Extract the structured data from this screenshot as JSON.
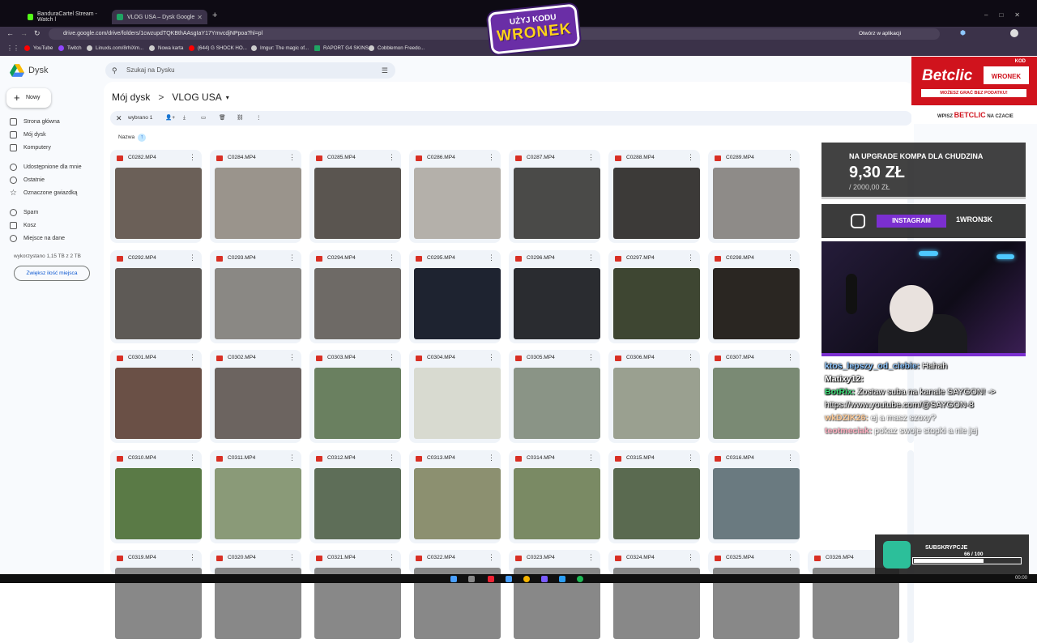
{
  "browser": {
    "tabs": [
      {
        "label": "BanduraCartel Stream - Watch l",
        "favicon_color": "#53fc18",
        "active": false
      },
      {
        "label": "VLOG USA – Dysk Google",
        "favicon_color": "#1fa463",
        "active": true
      }
    ],
    "new_tab_label": "+",
    "url": "drive.google.com/drive/folders/1cwzupdTQKBthAAsgIaY17YmvcdjNPpoa?hl=pl",
    "open_in_app_label": "Otwórz w aplikacji",
    "bookmarks": [
      {
        "label": "YouTube",
        "color": "#ff0000"
      },
      {
        "label": "Twitch",
        "color": "#9146ff"
      },
      {
        "label": "Linuxls.com/8rhiXm...",
        "color": "#cccccc"
      },
      {
        "label": "Nowa karta",
        "color": "#cccccc"
      },
      {
        "label": "(644) G SHOCK HO...",
        "color": "#ff0000"
      },
      {
        "label": "Imgur: The magic of...",
        "color": "#cccccc"
      },
      {
        "label": "RAPORT G4 SKINS",
        "color": "#1fa463"
      },
      {
        "label": "Cobblemon Freedo...",
        "color": "#cccccc"
      }
    ]
  },
  "promo_badge": {
    "line1": "UŻYJ KODU",
    "line2": "WRONEK"
  },
  "drive": {
    "app_name": "Dysk",
    "search_placeholder": "Szukaj na Dysku",
    "new_button": "Nowy",
    "nav": [
      {
        "label": "Strona główna",
        "icon": "home-icon"
      },
      {
        "label": "Mój dysk",
        "icon": "drive-icon"
      },
      {
        "label": "Komputery",
        "icon": "computer-icon"
      },
      {
        "label": "Udostępnione dla mnie",
        "icon": "shared-icon"
      },
      {
        "label": "Ostatnie",
        "icon": "clock-icon"
      },
      {
        "label": "Oznaczone gwiazdką",
        "icon": "star-icon"
      },
      {
        "label": "Spam",
        "icon": "spam-icon"
      },
      {
        "label": "Kosz",
        "icon": "trash-icon"
      },
      {
        "label": "Miejsce na dane",
        "icon": "cloud-icon"
      }
    ],
    "storage_text": "wykorzystano 1,15 TB z 2 TB",
    "storage_fraction": 0.575,
    "more_storage_button": "Zwiększ ilość miejsca",
    "breadcrumb": {
      "root": "Mój dysk",
      "separator": ">",
      "current": "VLOG USA"
    },
    "selection": {
      "label": "wybrano 1"
    },
    "sort_label": "Nazwa",
    "files": [
      {
        "name": "C0282.MP4",
        "thumb": "#6b6058"
      },
      {
        "name": "C0284.MP4",
        "thumb": "#9a948c"
      },
      {
        "name": "C0285.MP4",
        "thumb": "#5a5550"
      },
      {
        "name": "C0286.MP4",
        "thumb": "#b4b0aa"
      },
      {
        "name": "C0287.MP4",
        "thumb": "#4a4a48"
      },
      {
        "name": "C0288.MP4",
        "thumb": "#3c3a38"
      },
      {
        "name": "C0289.MP4",
        "thumb": "#8e8b88"
      },
      {
        "name": "C0292.MP4",
        "thumb": "#5e5a56"
      },
      {
        "name": "C0293.MP4",
        "thumb": "#8a8884"
      },
      {
        "name": "C0294.MP4",
        "thumb": "#6e6a66"
      },
      {
        "name": "C0295.MP4",
        "thumb": "#1e2330"
      },
      {
        "name": "C0296.MP4",
        "thumb": "#2a2c30"
      },
      {
        "name": "C0297.MP4",
        "thumb": "#3e4632"
      },
      {
        "name": "C0298.MP4",
        "thumb": "#2a2622"
      },
      {
        "name": "C0301.MP4",
        "thumb": "#6a5046"
      },
      {
        "name": "C0302.MP4",
        "thumb": "#6c6460"
      },
      {
        "name": "C0303.MP4",
        "thumb": "#6a8060"
      },
      {
        "name": "C0304.MP4",
        "thumb": "#d8dad0"
      },
      {
        "name": "C0305.MP4",
        "thumb": "#8a9486"
      },
      {
        "name": "C0306.MP4",
        "thumb": "#9aa090"
      },
      {
        "name": "C0307.MP4",
        "thumb": "#7a8a74"
      },
      {
        "name": "C0310.MP4",
        "thumb": "#5a7a46"
      },
      {
        "name": "C0311.MP4",
        "thumb": "#8a9a78"
      },
      {
        "name": "C0312.MP4",
        "thumb": "#5e6e58"
      },
      {
        "name": "C0313.MP4",
        "thumb": "#8c9070"
      },
      {
        "name": "C0314.MP4",
        "thumb": "#7a8a64"
      },
      {
        "name": "C0315.MP4",
        "thumb": "#5a6a50"
      },
      {
        "name": "C0316.MP4",
        "thumb": "#6a7a80"
      },
      {
        "name": "C0319.MP4",
        "thumb": "#888888"
      },
      {
        "name": "C0320.MP4",
        "thumb": "#888888"
      },
      {
        "name": "C0321.MP4",
        "thumb": "#888888"
      },
      {
        "name": "C0322.MP4",
        "thumb": "#888888"
      },
      {
        "name": "C0323.MP4",
        "thumb": "#888888"
      },
      {
        "name": "C0324.MP4",
        "thumb": "#888888"
      },
      {
        "name": "C0325.MP4",
        "thumb": "#888888"
      },
      {
        "name": "C0326.MP4",
        "thumb": "#888888"
      }
    ]
  },
  "overlays": {
    "betclic": {
      "brand": "Betclic",
      "kod_label": "KOD",
      "code": "WRONEK",
      "subline": "MOŻESZ GRAĆ BEZ PODATKU!",
      "wpisz": "WPISZ",
      "betclic_word": "BETCLIC",
      "na_czacie": "NA CZACIE"
    },
    "donation_goal": {
      "title": "NA UPGRADE KOMPA DLA CHUDZINA",
      "amount": "9,30 ZŁ",
      "target": "/ 2000,00 ZŁ"
    },
    "instagram": {
      "label": "INSTAGRAM",
      "handle": "1WRON3K"
    },
    "chat": [
      {
        "user": "ktos_lepszy_od_ciebie:",
        "message": "Hahah",
        "user_class": "u1"
      },
      {
        "user": "Matixy12:",
        "message": "",
        "user_class": "u2"
      },
      {
        "user": "BotRix:",
        "message": "Zostaw suba na kanale SAYGON! -> https://www.youtube.com/@SAYGON-8",
        "user_class": "u3"
      },
      {
        "user": "wkDZIK26:",
        "message": "ej a masz szoxy?",
        "user_class": "u4"
      },
      {
        "user": "teotmeciak:",
        "message": "pokaz swoje stopki a nie jej",
        "user_class": "u5"
      }
    ],
    "subs": {
      "label": "SUBSKRYPCJE",
      "current": "66",
      "goal": "/ 100",
      "fraction": 0.66
    }
  },
  "taskbar": {
    "clock": "00:00"
  }
}
